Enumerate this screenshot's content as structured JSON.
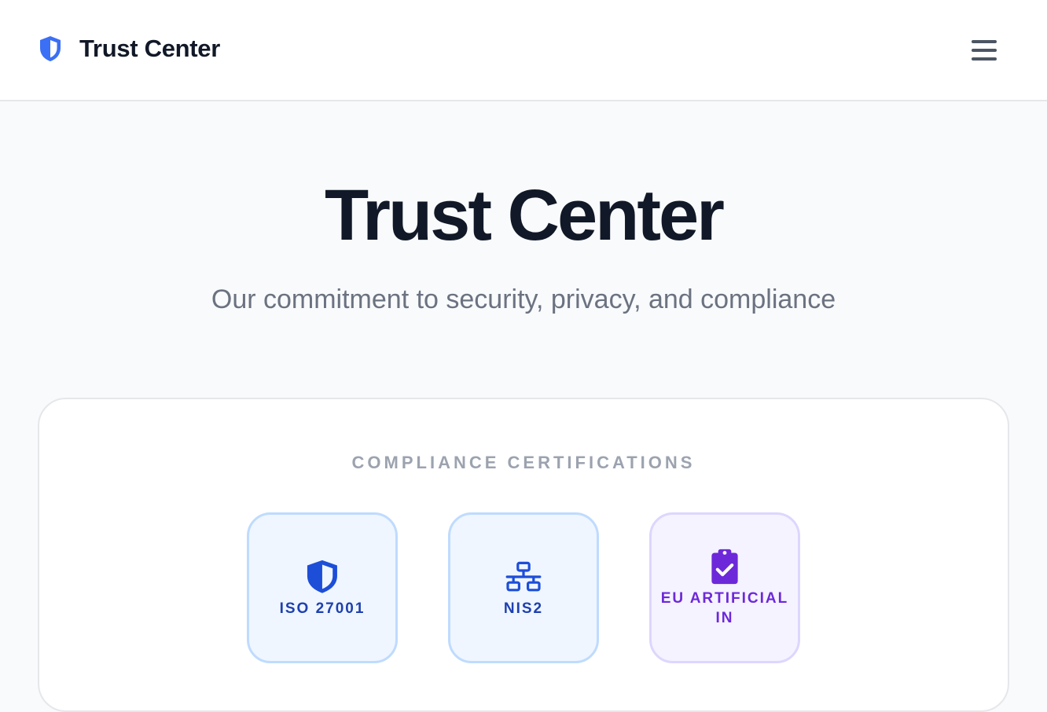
{
  "header": {
    "brand_icon": "shield-icon",
    "brand_name": "Trust Center",
    "menu_icon": "hamburger-menu-icon"
  },
  "hero": {
    "title": "Trust Center",
    "subtitle": "Our commitment to security, privacy, and compliance"
  },
  "certifications": {
    "heading": "COMPLIANCE CERTIFICATIONS",
    "items": [
      {
        "label": "ISO 27001",
        "icon": "shield-icon",
        "color": "#1d4ed8"
      },
      {
        "label": "NIS2",
        "icon": "network-icon",
        "color": "#1d4ed8"
      },
      {
        "label": "EU ARTIFICIAL IN",
        "icon": "clipboard-check-icon",
        "color": "#6d28d9"
      }
    ]
  },
  "colors": {
    "brand_accent": "#3b6ff5",
    "title_text": "#111827",
    "muted_text": "#6b7280",
    "badge_blue_bg": "#eff6ff",
    "badge_purple_bg": "#f5f3ff"
  }
}
